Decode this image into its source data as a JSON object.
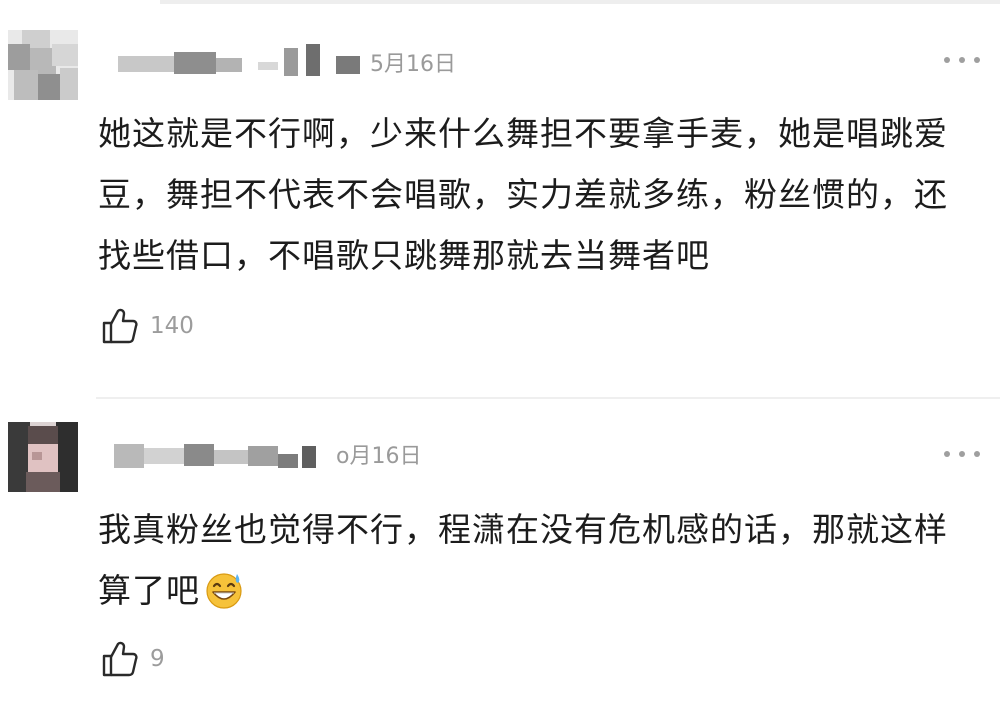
{
  "comments": [
    {
      "username": "",
      "date": "5月16日",
      "text": "她这就是不行啊，少来什么舞担不要拿手麦，她是唱跳爱豆，舞担不代表不会唱歌，实力差就多练，粉丝惯的，还找些借口，不唱歌只跳舞那就去当舞者吧",
      "likes": "140",
      "like_icon": "thumbs-up-outline-icon",
      "more_icon": "three-dots-icon"
    },
    {
      "username": "",
      "date": "o月16日",
      "text": "我真粉丝也觉得不行，程潇在没有危机感的话，那就这样算了吧",
      "emoji": "sweat-smile-emoji",
      "likes": "9",
      "like_icon": "thumbs-up-outline-icon",
      "more_icon": "three-dots-icon"
    }
  ],
  "colors": {
    "text": "#1c1c1c",
    "meta": "#9a9a9a",
    "divider": "#efefef",
    "background": "#ffffff"
  }
}
